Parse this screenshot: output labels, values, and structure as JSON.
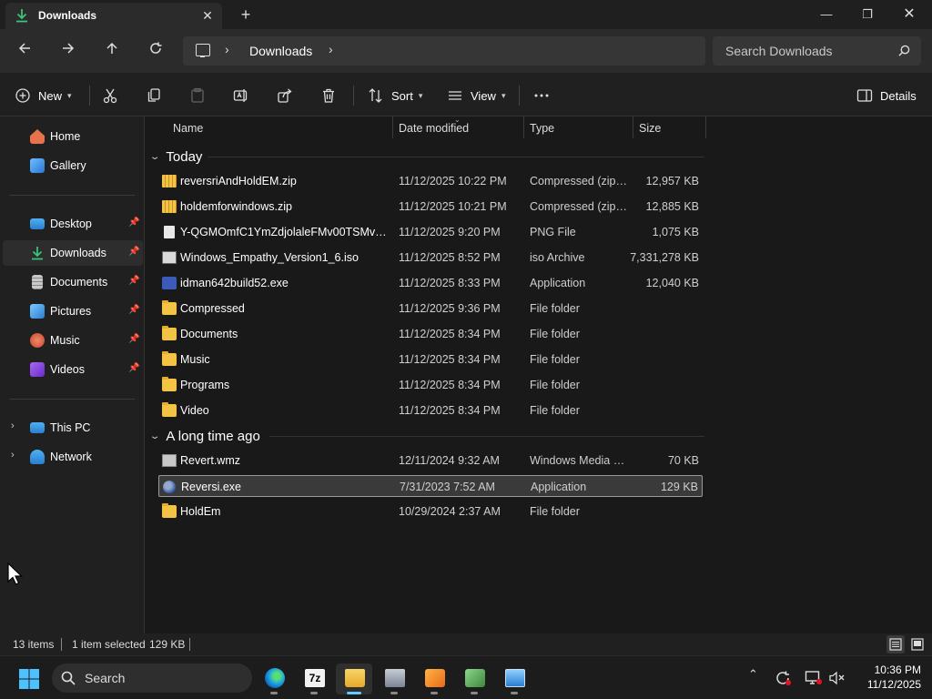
{
  "tab": {
    "title": "Downloads"
  },
  "address": {
    "crumb": "Downloads"
  },
  "search": {
    "placeholder": "Search Downloads"
  },
  "commands": {
    "new_label": "New",
    "sort_label": "Sort",
    "view_label": "View",
    "details_label": "Details"
  },
  "sidebar": {
    "items": [
      {
        "label": "Home",
        "icon": "home-icon",
        "color": "#e8734a"
      },
      {
        "label": "Gallery",
        "icon": "gallery-icon",
        "color": "#3a8ee6"
      },
      {
        "label": "Desktop",
        "icon": "desktop-icon",
        "color": "#3aa0e6",
        "pinned": true
      },
      {
        "label": "Downloads",
        "icon": "downloads-icon",
        "color": "#3cc27a",
        "pinned": true,
        "active": true
      },
      {
        "label": "Documents",
        "icon": "documents-icon",
        "color": "#b8b8b8",
        "pinned": true
      },
      {
        "label": "Pictures",
        "icon": "pictures-icon",
        "color": "#3a9ae6",
        "pinned": true
      },
      {
        "label": "Music",
        "icon": "music-icon",
        "color": "#e86a4a",
        "pinned": true
      },
      {
        "label": "Videos",
        "icon": "videos-icon",
        "color": "#8a4ae8",
        "pinned": true
      },
      {
        "label": "This PC",
        "icon": "this-pc-icon",
        "color": "#3aa0e6"
      },
      {
        "label": "Network",
        "icon": "network-icon",
        "color": "#3aa0e6"
      }
    ]
  },
  "columns": {
    "name": "Name",
    "date": "Date modified",
    "type": "Type",
    "size": "Size"
  },
  "groups": {
    "today": "Today",
    "older": "A long time ago"
  },
  "files_today": [
    {
      "name": "reversriAndHoldEM.zip",
      "date": "11/12/2025 10:22 PM",
      "type": "Compressed (zipp...",
      "size": "12,957 KB",
      "icon": "zip"
    },
    {
      "name": "holdemforwindows.zip",
      "date": "11/12/2025 10:21 PM",
      "type": "Compressed (zipp...",
      "size": "12,885 KB",
      "icon": "zip"
    },
    {
      "name": "Y-QGMOmfC1YmZdjolaleFMv00TSMvkjJ...",
      "date": "11/12/2025 9:20 PM",
      "type": "PNG File",
      "size": "1,075 KB",
      "icon": "file"
    },
    {
      "name": "Windows_Empathy_Version1_6.iso",
      "date": "11/12/2025 8:52 PM",
      "type": "iso Archive",
      "size": "7,331,278 KB",
      "icon": "iso"
    },
    {
      "name": "idman642build52.exe",
      "date": "11/12/2025 8:33 PM",
      "type": "Application",
      "size": "12,040 KB",
      "icon": "exe"
    },
    {
      "name": "Compressed",
      "date": "11/12/2025 9:36 PM",
      "type": "File folder",
      "size": "",
      "icon": "folder"
    },
    {
      "name": "Documents",
      "date": "11/12/2025 8:34 PM",
      "type": "File folder",
      "size": "",
      "icon": "folder"
    },
    {
      "name": "Music",
      "date": "11/12/2025 8:34 PM",
      "type": "File folder",
      "size": "",
      "icon": "folder"
    },
    {
      "name": "Programs",
      "date": "11/12/2025 8:34 PM",
      "type": "File folder",
      "size": "",
      "icon": "folder"
    },
    {
      "name": "Video",
      "date": "11/12/2025 8:34 PM",
      "type": "File folder",
      "size": "",
      "icon": "folder"
    }
  ],
  "files_older": [
    {
      "name": "Revert.wmz",
      "date": "12/11/2024 9:32 AM",
      "type": "Windows Media P...",
      "size": "70 KB",
      "icon": "wmz"
    },
    {
      "name": "Reversi.exe",
      "date": "7/31/2023 7:52 AM",
      "type": "Application",
      "size": "129 KB",
      "icon": "rev",
      "selected": true
    },
    {
      "name": "HoldEm",
      "date": "10/29/2024 2:37 AM",
      "type": "File folder",
      "size": "",
      "icon": "folder"
    }
  ],
  "status": {
    "count": "13 items",
    "selection": "1 item selected",
    "selection_size": "129 KB"
  },
  "taskbar": {
    "search_label": "Search",
    "time": "10:36 PM",
    "date": "11/12/2025"
  },
  "colors": {
    "accent": "#60cdff",
    "folder": "#f3c443"
  }
}
